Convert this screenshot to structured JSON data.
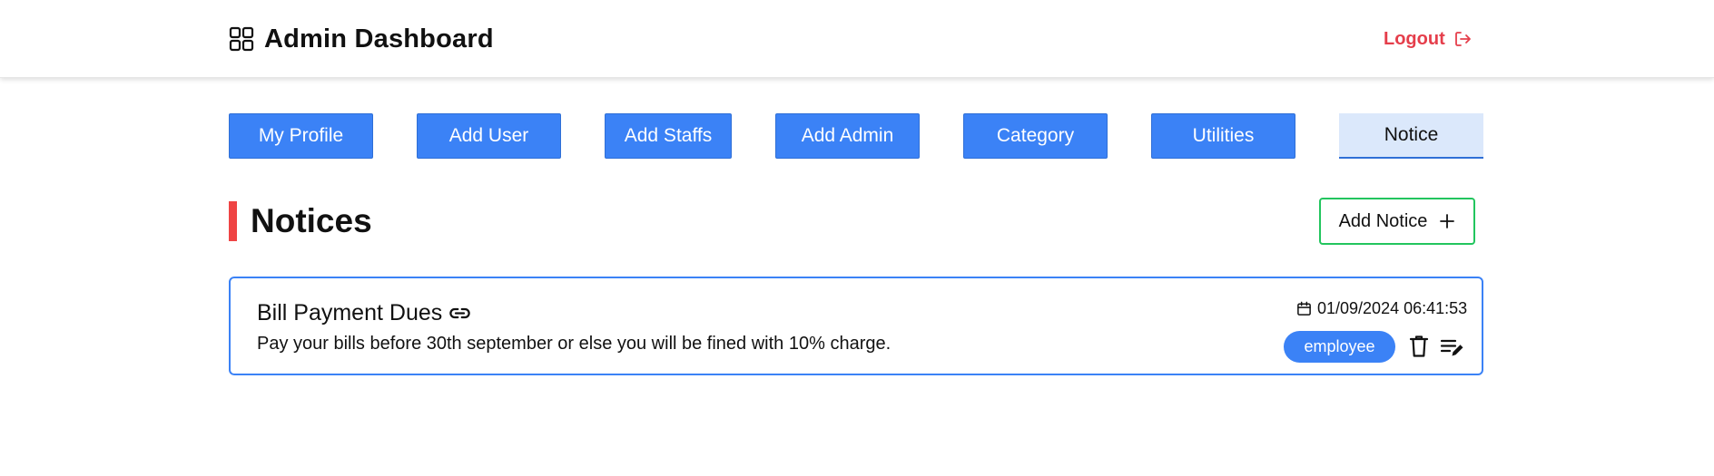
{
  "header": {
    "title": "Admin Dashboard",
    "logout_label": "Logout"
  },
  "tabs": [
    {
      "label": "My Profile",
      "active": false
    },
    {
      "label": "Add User",
      "active": false
    },
    {
      "label": "Add Staffs",
      "active": false
    },
    {
      "label": "Add Admin",
      "active": false
    },
    {
      "label": "Category",
      "active": false
    },
    {
      "label": "Utilities",
      "active": false
    },
    {
      "label": "Notice",
      "active": true
    }
  ],
  "section": {
    "title": "Notices",
    "add_button_label": "Add Notice"
  },
  "notices": [
    {
      "title": "Bill Payment Dues",
      "description": "Pay your bills before 30th september or else you will be fined with 10% charge.",
      "date": "01/09/2024 06:41:53",
      "role": "employee"
    }
  ],
  "icons": {
    "brand": "grid-icon",
    "logout": "logout-icon",
    "add": "plus-icon",
    "link": "link-icon",
    "date": "calendar-icon",
    "delete": "trash-icon",
    "edit": "edit-icon"
  },
  "colors": {
    "primary": "#3b82f6",
    "danger": "#e53e4b",
    "accent_bar": "#ef4444",
    "add_button_border": "#22c55e",
    "active_tab_bg": "#dbe8fb"
  }
}
